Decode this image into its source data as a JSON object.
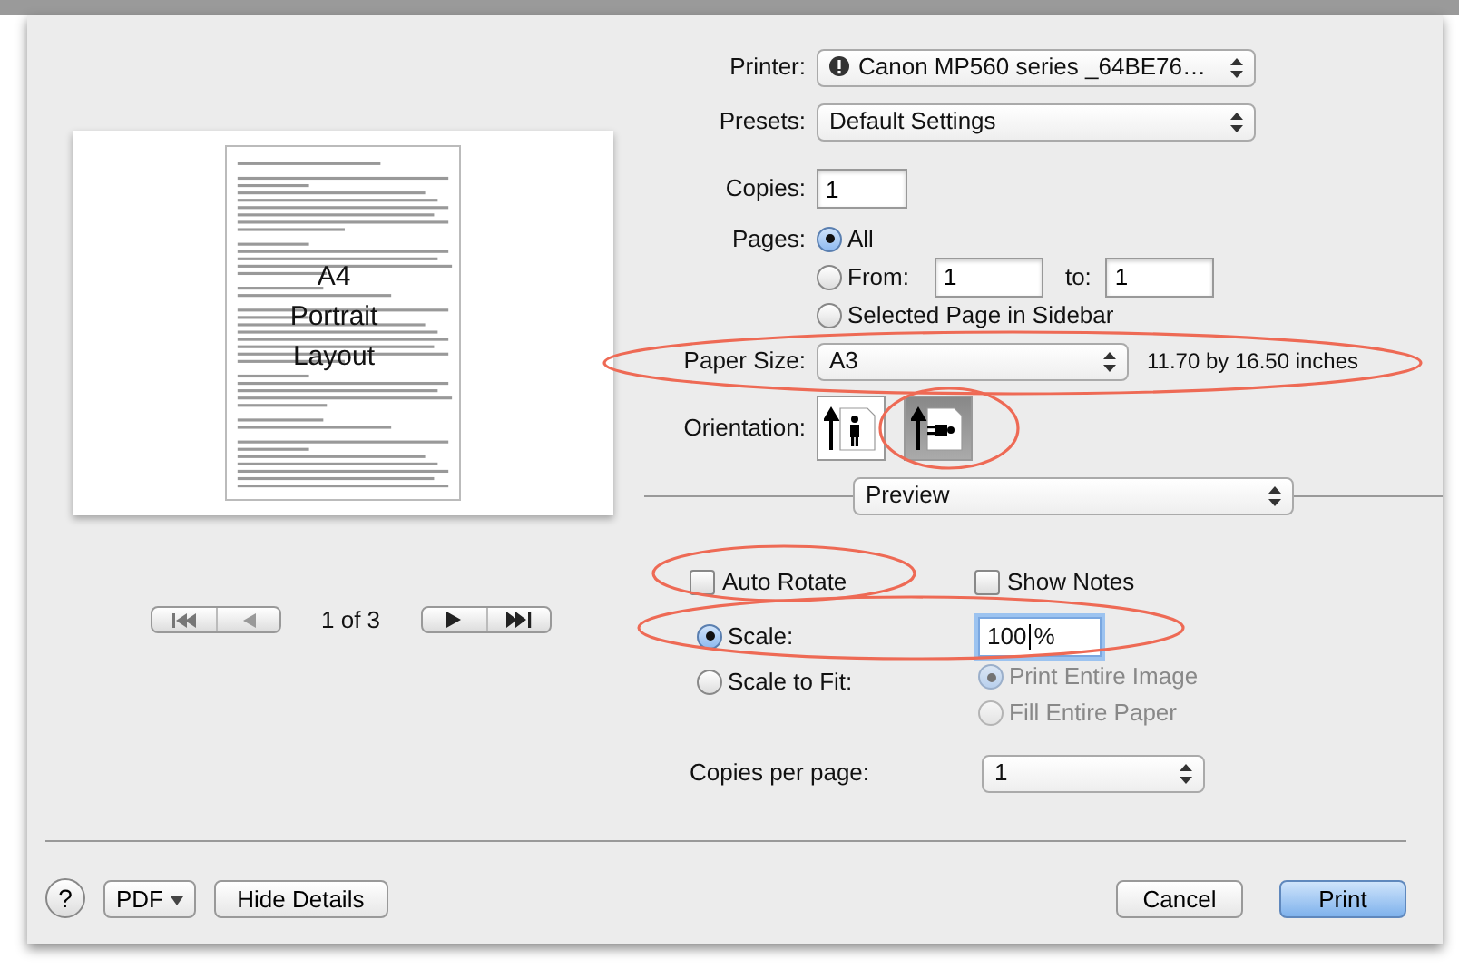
{
  "preview": {
    "overlay_lines": [
      "A4",
      "Portrait",
      "Layout"
    ],
    "page_indicator": "1 of 3"
  },
  "printer": {
    "label": "Printer:",
    "value": "Canon MP560 series _64BE76…"
  },
  "presets": {
    "label": "Presets:",
    "value": "Default Settings"
  },
  "copies": {
    "label": "Copies:",
    "value": "1"
  },
  "pages": {
    "label": "Pages:",
    "options": [
      {
        "kind": "all",
        "label": "All",
        "selected": true
      },
      {
        "kind": "range",
        "label": "From:",
        "selected": false,
        "from": "1",
        "to_label": "to:",
        "to": "1"
      },
      {
        "kind": "sidebar",
        "label": "Selected Page in Sidebar",
        "selected": false
      }
    ]
  },
  "paper_size": {
    "label": "Paper Size:",
    "value": "A3",
    "dimensions": "11.70 by 16.50 inches"
  },
  "orientation": {
    "label": "Orientation:",
    "options": [
      {
        "kind": "portrait",
        "selected": false
      },
      {
        "kind": "landscape",
        "selected": true
      }
    ]
  },
  "panel": {
    "value": "Preview"
  },
  "checkboxes": [
    {
      "label": "Auto Rotate",
      "checked": false
    },
    {
      "label": "Show Notes",
      "checked": false
    }
  ],
  "scale": {
    "options": [
      {
        "label": "Scale:",
        "selected": true,
        "value": "100",
        "unit": "%"
      },
      {
        "label": "Scale to Fit:",
        "selected": false
      }
    ],
    "fit_options": [
      {
        "label": "Print Entire Image",
        "selected": true,
        "disabled": true
      },
      {
        "label": "Fill Entire Paper",
        "selected": false,
        "disabled": true
      }
    ]
  },
  "copies_per_page": {
    "label": "Copies per page:",
    "value": "1"
  },
  "footer": {
    "help": "?",
    "pdf": "PDF",
    "details": "Hide Details",
    "buttons": [
      {
        "label": "Cancel",
        "default": false
      },
      {
        "label": "Print",
        "default": true
      }
    ]
  }
}
